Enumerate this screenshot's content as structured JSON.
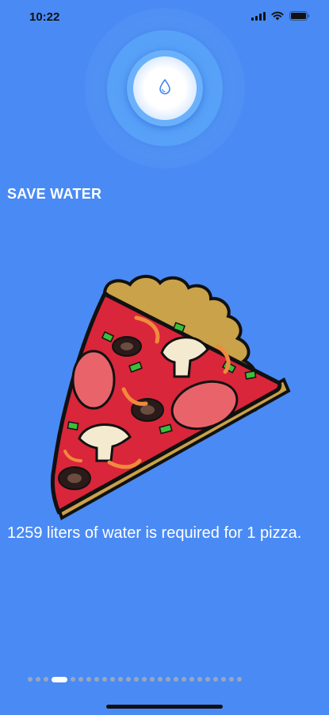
{
  "status_bar": {
    "time": "10:22"
  },
  "header": {
    "logo_icon": "water-drop-icon",
    "title": "SAVE WATER"
  },
  "content": {
    "image_icon": "pizza-slice-illustration",
    "fact_text": "1259 liters of water is required for 1 pizza."
  },
  "pager": {
    "total_pages": 26,
    "current_page": 4
  },
  "colors": {
    "background": "#4a8af4",
    "text": "#ffffff"
  }
}
